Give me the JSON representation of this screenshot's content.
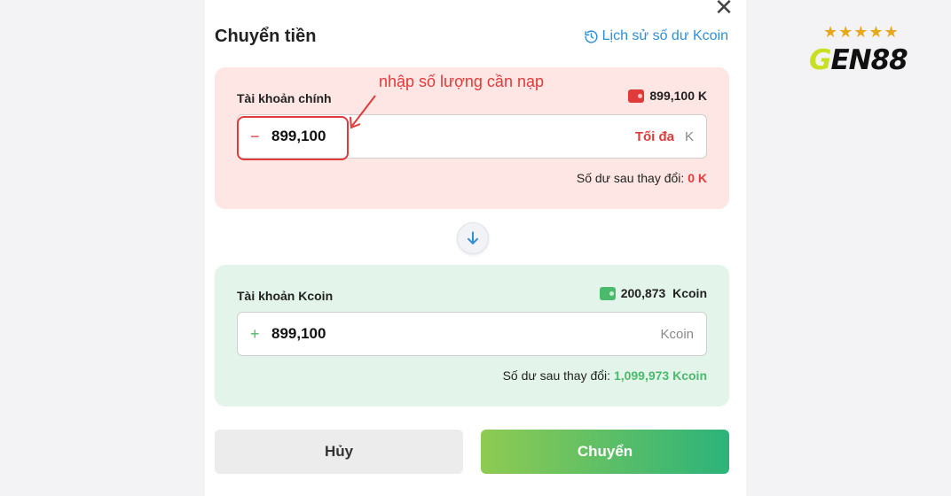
{
  "modal": {
    "title": "Chuyển tiền",
    "close_glyph": "✕",
    "history_link": "Lịch sử số dư Kcoin"
  },
  "main_account": {
    "label": "Tài khoản chính",
    "balance": "899,100 K",
    "input_sign": "−",
    "input_value": "899,100",
    "max_label": "Tối đa",
    "unit": "K",
    "after_label": "Số dư sau thay đổi:",
    "after_value": "0 K"
  },
  "annotation": {
    "text": "nhập số lượng cần nạp"
  },
  "kcoin_account": {
    "label": "Tài khoản Kcoin",
    "balance": "200,873  Kcoin",
    "input_sign": "+",
    "input_value": "899,100",
    "unit": "Kcoin",
    "after_label": "Số dư sau thay đổi:",
    "after_value": "1,099,973 Kcoin"
  },
  "buttons": {
    "cancel": "Hủy",
    "confirm": "Chuyển"
  },
  "logo": {
    "stars": "★★★★★",
    "brand_first": "G",
    "brand_rest": "EN88"
  },
  "colors": {
    "accent_blue": "#2e8fd6",
    "danger_red": "#e03a3a",
    "success_green": "#4cba6c",
    "main_card_bg": "#fde6e3",
    "kcoin_card_bg": "#e3f4ea"
  },
  "icons": {
    "history": "history-clock-icon",
    "swap": "arrow-down-icon",
    "wallet": "wallet-icon",
    "close": "close-icon"
  }
}
